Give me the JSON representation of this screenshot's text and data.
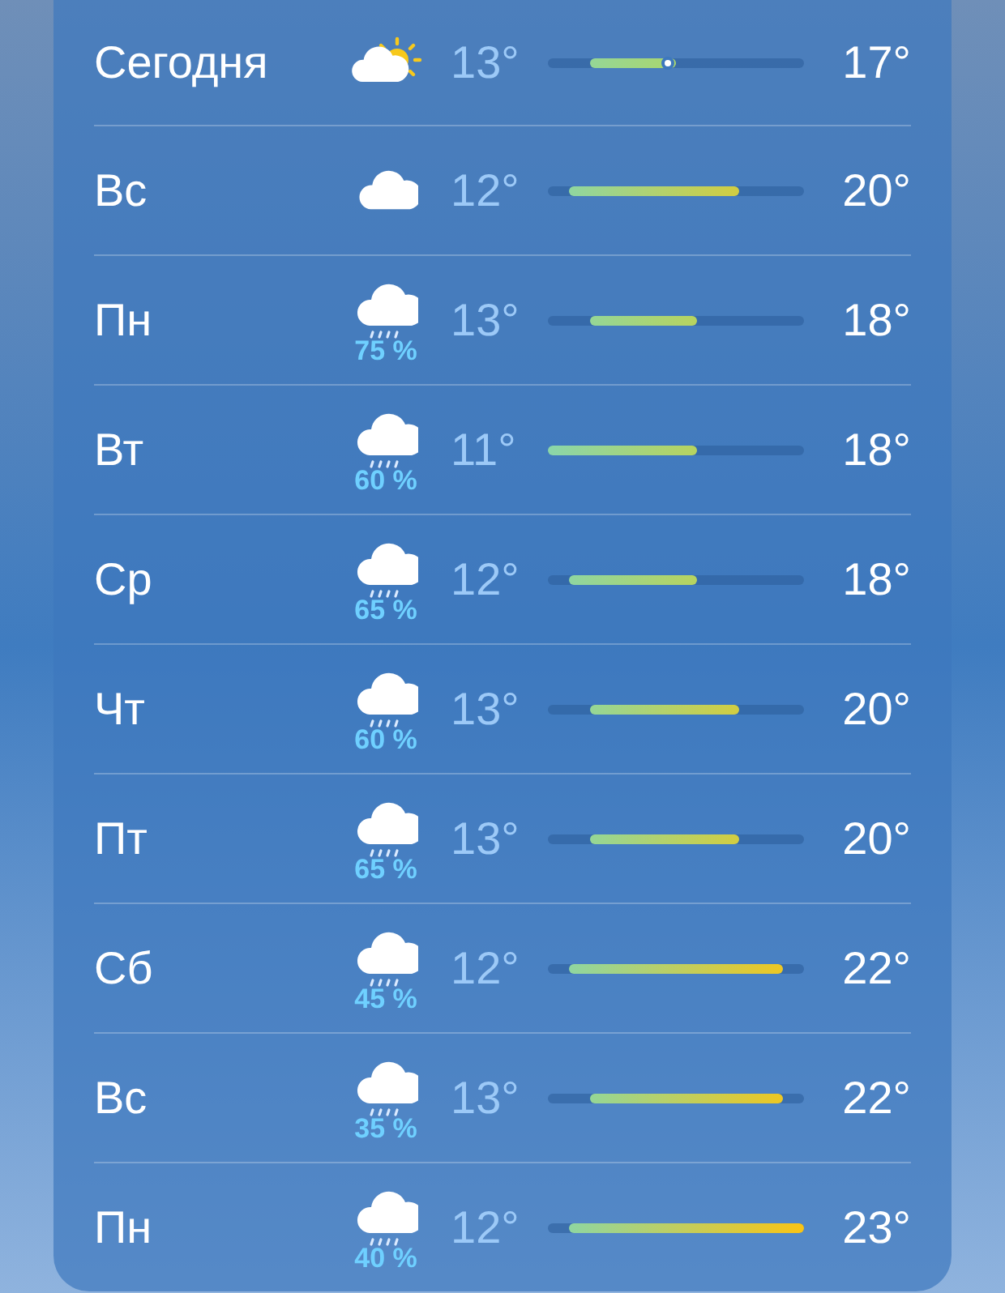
{
  "days": [
    {
      "day": "Сегодня",
      "kind": "partly_sunny",
      "low": "13°",
      "high": "17°",
      "marker": {
        "level": 0.47
      }
    },
    {
      "day": "Вс",
      "kind": "cloudy",
      "low": "12°",
      "high": "20°"
    },
    {
      "day": "Пн",
      "kind": "rain",
      "precip": "75 %",
      "low": "13°",
      "high": "18°"
    },
    {
      "day": "Вт",
      "kind": "rain",
      "precip": "60 %",
      "low": "11°",
      "high": "18°"
    },
    {
      "day": "Ср",
      "kind": "rain",
      "precip": "65 %",
      "low": "12°",
      "high": "18°"
    },
    {
      "day": "Чт",
      "kind": "rain",
      "precip": "60 %",
      "low": "13°",
      "high": "20°"
    },
    {
      "day": "Пт",
      "kind": "rain",
      "precip": "65 %",
      "low": "13°",
      "high": "20°"
    },
    {
      "day": "Сб",
      "kind": "rain",
      "precip": "45 %",
      "low": "12°",
      "high": "22°"
    },
    {
      "day": "Вс",
      "kind": "rain",
      "precip": "35 %",
      "low": "13°",
      "high": "22°"
    },
    {
      "day": "Пн",
      "kind": "rain",
      "precip": "40 %",
      "low": "12°",
      "high": "23°"
    }
  ]
}
